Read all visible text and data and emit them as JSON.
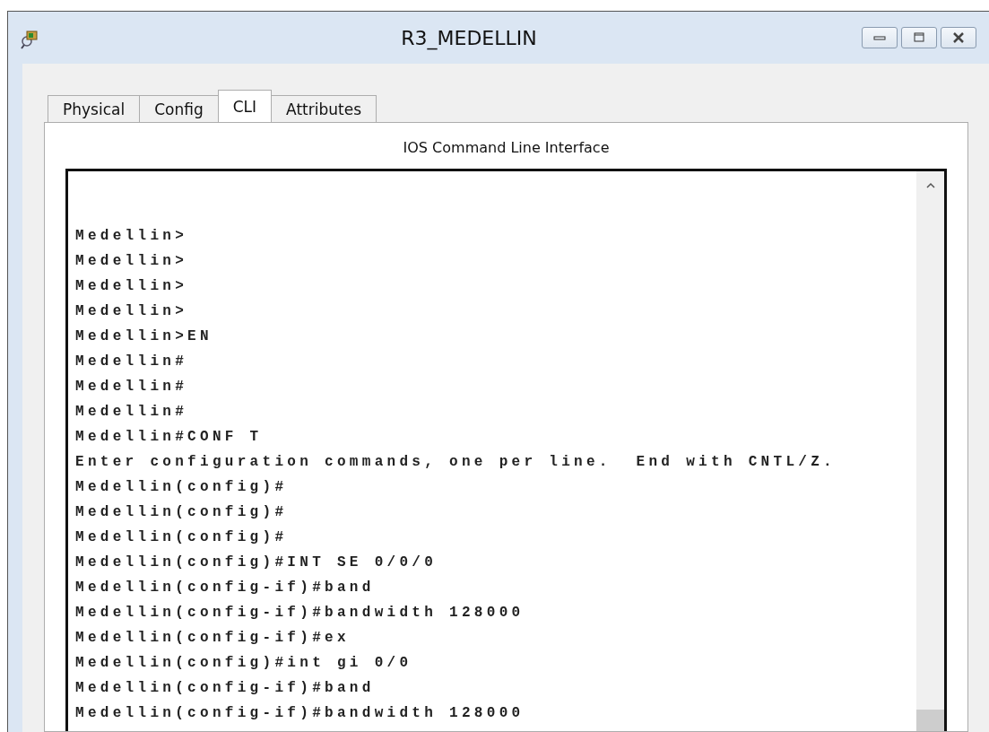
{
  "window": {
    "title": "R3_MEDELLIN"
  },
  "tabs": [
    {
      "label": "Physical",
      "selected": false
    },
    {
      "label": "Config",
      "selected": false
    },
    {
      "label": "CLI",
      "selected": true
    },
    {
      "label": "Attributes",
      "selected": false
    }
  ],
  "panel_title": "IOS Command Line Interface",
  "terminal_lines": [
    "Medellin>",
    "Medellin>",
    "Medellin>",
    "Medellin>",
    "Medellin>EN",
    "Medellin#",
    "Medellin#",
    "Medellin#",
    "Medellin#CONF T",
    "Enter configuration commands, one per line.  End with CNTL/Z.",
    "Medellin(config)#",
    "Medellin(config)#",
    "Medellin(config)#",
    "Medellin(config)#INT SE 0/0/0",
    "Medellin(config-if)#band",
    "Medellin(config-if)#bandwidth 128000",
    "Medellin(config-if)#ex",
    "Medellin(config)#int gi 0/0",
    "Medellin(config-if)#band",
    "Medellin(config-if)#bandwidth 128000"
  ]
}
